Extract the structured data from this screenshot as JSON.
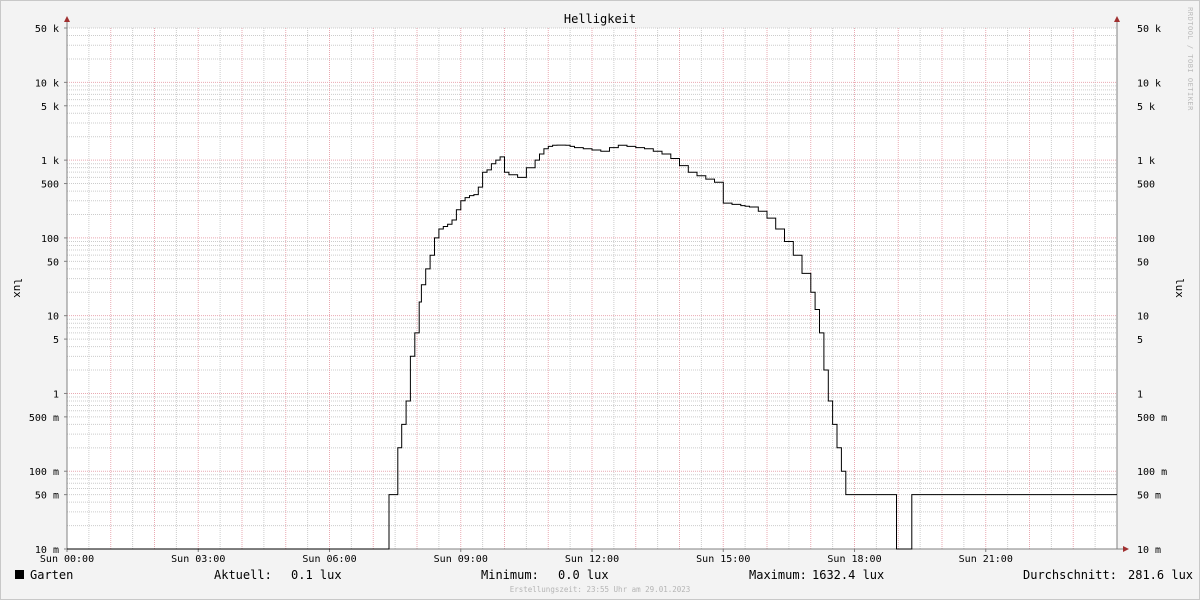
{
  "chart_data": {
    "type": "line",
    "title": "Helligkeit",
    "ylabel": "lux",
    "yscale": "log",
    "ylim": [
      0.01,
      50000
    ],
    "xlim": [
      0,
      24
    ],
    "y_ticks": [
      {
        "value": 50000,
        "label": "50 k"
      },
      {
        "value": 10000,
        "label": "10 k"
      },
      {
        "value": 5000,
        "label": "5 k"
      },
      {
        "value": 1000,
        "label": "1 k"
      },
      {
        "value": 500,
        "label": "500"
      },
      {
        "value": 100,
        "label": "100"
      },
      {
        "value": 50,
        "label": "50"
      },
      {
        "value": 10,
        "label": "10"
      },
      {
        "value": 5,
        "label": "5"
      },
      {
        "value": 1,
        "label": "1"
      },
      {
        "value": 0.5,
        "label": "500 m"
      },
      {
        "value": 0.1,
        "label": "100 m"
      },
      {
        "value": 0.05,
        "label": "50 m"
      },
      {
        "value": 0.01,
        "label": "10 m"
      }
    ],
    "x_ticks": [
      {
        "value": 0,
        "label": "Sun 00:00"
      },
      {
        "value": 3,
        "label": "Sun 03:00"
      },
      {
        "value": 6,
        "label": "Sun 06:00"
      },
      {
        "value": 9,
        "label": "Sun 09:00"
      },
      {
        "value": 12,
        "label": "Sun 12:00"
      },
      {
        "value": 15,
        "label": "Sun 15:00"
      },
      {
        "value": 18,
        "label": "Sun 18:00"
      },
      {
        "value": 21,
        "label": "Sun 21:00"
      }
    ],
    "grid": true,
    "series": [
      {
        "name": "Garten",
        "color": "#000000",
        "x": [
          0,
          7.35,
          7.36,
          7.55,
          7.56,
          7.65,
          7.75,
          7.85,
          7.95,
          8.05,
          8.1,
          8.2,
          8.3,
          8.4,
          8.5,
          8.6,
          8.7,
          8.8,
          8.9,
          9.0,
          9.1,
          9.2,
          9.3,
          9.4,
          9.5,
          9.6,
          9.7,
          9.8,
          9.9,
          10.0,
          10.1,
          10.3,
          10.5,
          10.7,
          10.8,
          10.9,
          11.0,
          11.1,
          11.2,
          11.3,
          11.4,
          11.5,
          11.6,
          11.8,
          12.0,
          12.2,
          12.4,
          12.6,
          12.8,
          13.0,
          13.2,
          13.4,
          13.6,
          13.8,
          14.0,
          14.2,
          14.4,
          14.6,
          14.8,
          15.0,
          15.2,
          15.4,
          15.5,
          15.6,
          15.8,
          16.0,
          16.2,
          16.4,
          16.6,
          16.8,
          17.0,
          17.1,
          17.2,
          17.3,
          17.4,
          17.5,
          17.6,
          17.7,
          17.8,
          17.9,
          17.95,
          18.0,
          18.2,
          18.5,
          18.95,
          18.96,
          19.3,
          19.31,
          24
        ],
        "values": [
          0.01,
          0.01,
          0.05,
          0.05,
          0.2,
          0.4,
          0.8,
          3,
          6,
          15,
          25,
          40,
          60,
          100,
          130,
          140,
          150,
          170,
          230,
          300,
          330,
          350,
          360,
          450,
          700,
          750,
          900,
          1000,
          1100,
          700,
          650,
          600,
          800,
          1000,
          1200,
          1400,
          1500,
          1550,
          1560,
          1560,
          1550,
          1500,
          1450,
          1400,
          1350,
          1300,
          1450,
          1550,
          1500,
          1450,
          1400,
          1300,
          1200,
          1050,
          850,
          700,
          630,
          570,
          520,
          280,
          270,
          260,
          255,
          250,
          220,
          180,
          130,
          90,
          60,
          35,
          20,
          12,
          6,
          2,
          0.8,
          0.4,
          0.2,
          0.1,
          0.05,
          0.05,
          0.05,
          0.05,
          0.05,
          0.05,
          0.05,
          0.01,
          0.01,
          0.05,
          0.05
        ]
      }
    ]
  },
  "watermark": "RRDTOOL / TOBI OETIKER",
  "footer": {
    "legend_name": "Garten",
    "legend_color": "#000000",
    "aktuell_label": "Aktuell:",
    "aktuell_value": "0.1 lux",
    "minimum_label": "Minimum:",
    "minimum_value": "0.0 lux",
    "maximum_label": "Maximum:",
    "maximum_value": "1632.4 lux",
    "avg_label": "Durchschnitt:",
    "avg_value": "281.6 lux"
  },
  "created": "Erstellungszeit: 23:55 Uhr am 29.01.2023",
  "colors": {
    "background": "#f3f3f3",
    "plot_background": "#ffffff",
    "major_grid": "#e9a9b2",
    "minor_grid": "#cccccc",
    "axis": "#808080",
    "arrow": "#a03030"
  }
}
